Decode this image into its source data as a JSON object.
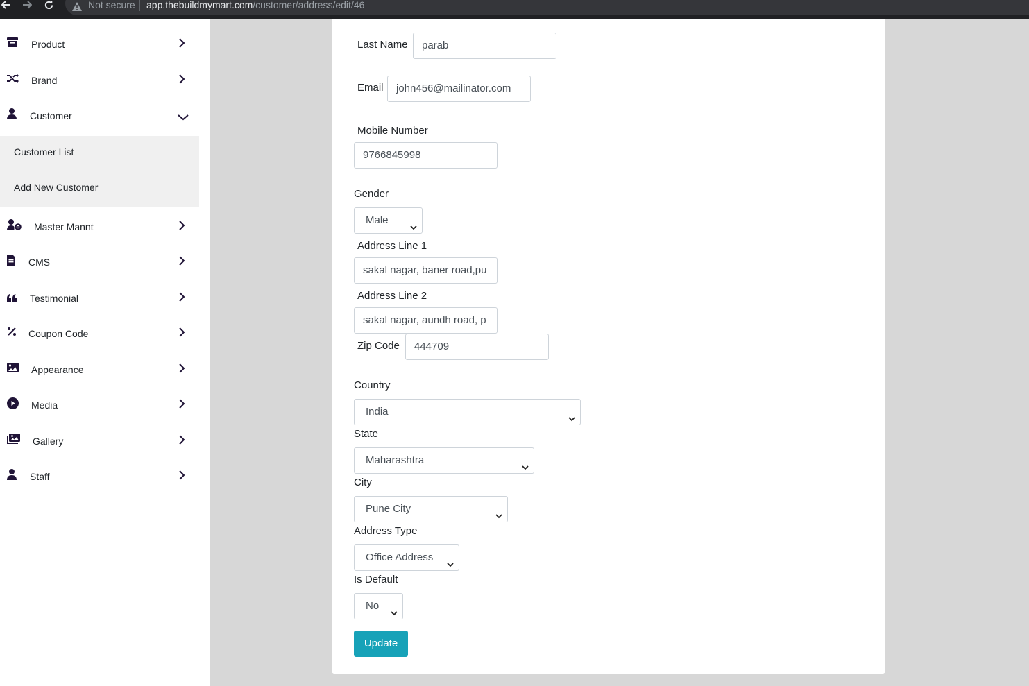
{
  "browser": {
    "security_label": "Not secure",
    "url_host": "app.thebuildmymart.com",
    "url_path": "/customer/address/edit/46"
  },
  "sidebar": {
    "items": [
      {
        "label": "Product",
        "icon": "archive-icon"
      },
      {
        "label": "Brand",
        "icon": "shuffle-icon"
      },
      {
        "label": "Customer",
        "icon": "user-icon",
        "expanded": true
      },
      {
        "label": "Master Mannt",
        "icon": "user-gear-icon"
      },
      {
        "label": "CMS",
        "icon": "file-icon"
      },
      {
        "label": "Testimonial",
        "icon": "quote-icon"
      },
      {
        "label": "Coupon Code",
        "icon": "percent-icon"
      },
      {
        "label": "Appearance",
        "icon": "image-icon"
      },
      {
        "label": "Media",
        "icon": "play-circle-icon"
      },
      {
        "label": "Gallery",
        "icon": "images-icon"
      },
      {
        "label": "Staff",
        "icon": "user-icon"
      }
    ],
    "customer_submenu": [
      "Customer List",
      "Add New Customer"
    ]
  },
  "form": {
    "last_name": {
      "label": "Last Name",
      "value": "parab"
    },
    "email": {
      "label": "Email",
      "value": "john456@mailinator.com"
    },
    "mobile": {
      "label": "Mobile Number",
      "value": "9766845998"
    },
    "gender": {
      "label": "Gender",
      "value": "Male"
    },
    "address1": {
      "label": "Address Line 1",
      "value": "sakal nagar, baner road,pu"
    },
    "address2": {
      "label": "Address Line 2",
      "value": "sakal nagar, aundh road, p"
    },
    "zip": {
      "label": "Zip Code",
      "value": "444709"
    },
    "country": {
      "label": "Country",
      "value": "India"
    },
    "state": {
      "label": "State",
      "value": "Maharashtra"
    },
    "city": {
      "label": "City",
      "value": "Pune City"
    },
    "address_type": {
      "label": "Address Type",
      "value": "Office Address"
    },
    "is_default": {
      "label": "Is Default",
      "value": "No"
    },
    "submit_label": "Update"
  },
  "colors": {
    "accent": "#17a2b8",
    "sidebar_icon": "#201437",
    "background": "#d7d7d7"
  }
}
